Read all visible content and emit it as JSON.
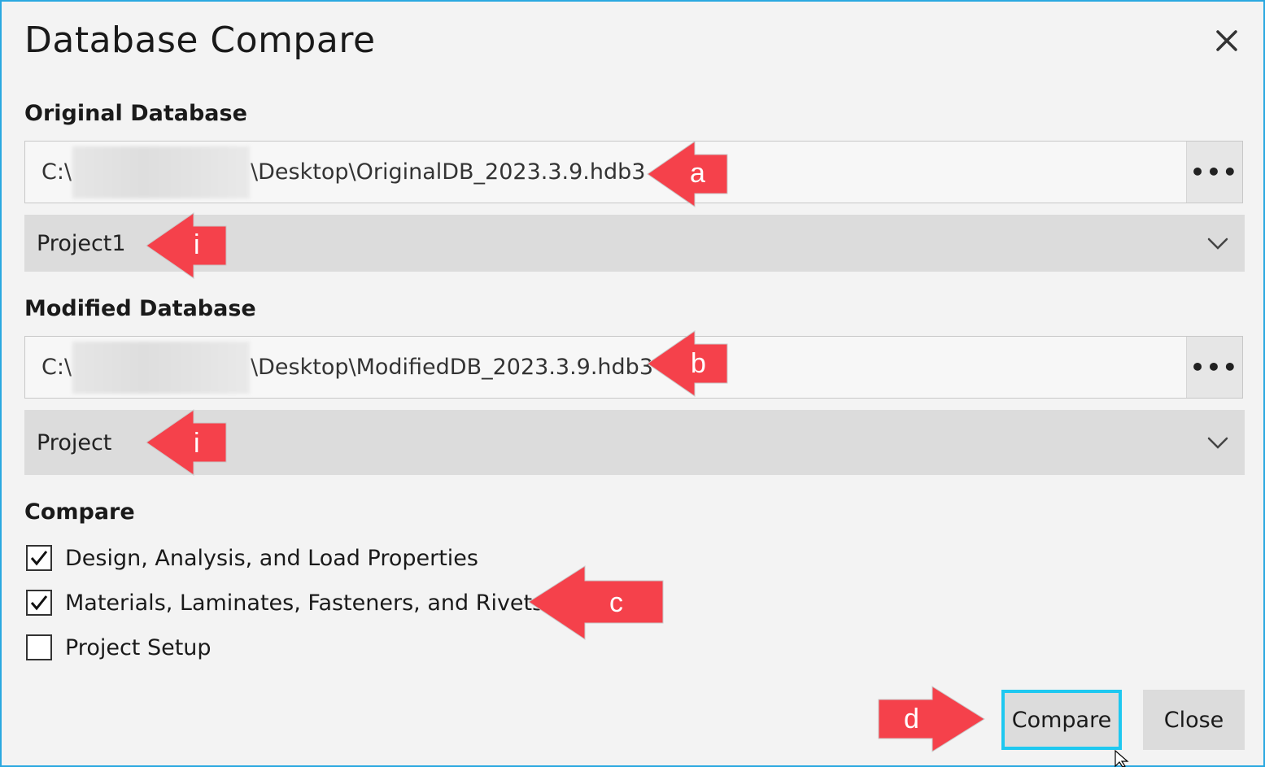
{
  "dialog": {
    "title": "Database Compare",
    "close_icon": "close-icon"
  },
  "original": {
    "label": "Original Database",
    "path_prefix": "C:\\",
    "path_suffix": "\\Desktop\\OriginalDB_2023.3.9.hdb3",
    "browse_label": "•••",
    "project_value": "Project1"
  },
  "modified": {
    "label": "Modified Database",
    "path_prefix": "C:\\",
    "path_suffix": "\\Desktop\\ModifiedDB_2023.3.9.hdb3",
    "browse_label": "•••",
    "project_value": "Project"
  },
  "compare": {
    "label": "Compare",
    "options": [
      {
        "label": "Design, Analysis, and Load Properties",
        "checked": true
      },
      {
        "label": "Materials, Laminates, Fasteners, and Rivets",
        "checked": true
      },
      {
        "label": "Project Setup",
        "checked": false
      }
    ]
  },
  "buttons": {
    "compare": "Compare",
    "close": "Close"
  },
  "callouts": {
    "a": "a",
    "b": "b",
    "i1": "i",
    "i2": "i",
    "c": "c",
    "d": "d"
  },
  "colors": {
    "accent": "#2aa8e0",
    "focus": "#1ec8f0",
    "callout": "#f5414b"
  }
}
